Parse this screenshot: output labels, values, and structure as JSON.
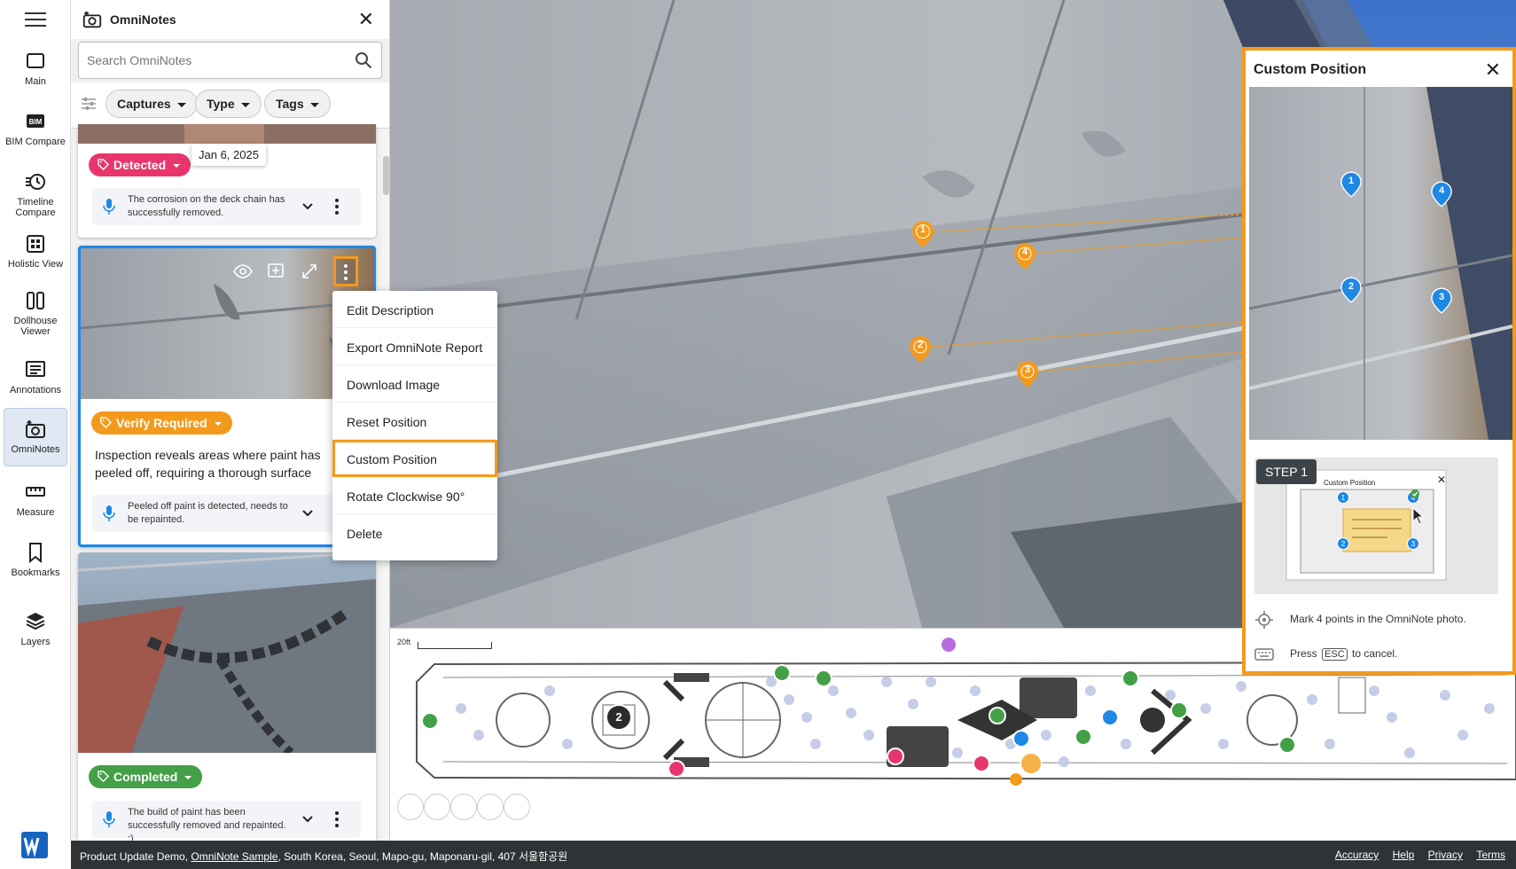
{
  "rail": {
    "items": [
      {
        "label": "Main",
        "icon": "square-icon"
      },
      {
        "label": "BIM Compare",
        "icon": "bim-icon"
      },
      {
        "label": "Timeline Compare",
        "icon": "timeline-icon"
      },
      {
        "label": "Holistic View",
        "icon": "grid-icon"
      },
      {
        "label": "Dollhouse Viewer",
        "icon": "dollhouse-icon"
      },
      {
        "label": "Annotations",
        "icon": "annotations-icon"
      },
      {
        "label": "OmniNotes",
        "icon": "camera-note-icon"
      },
      {
        "label": "Measure",
        "icon": "ruler-icon"
      },
      {
        "label": "Bookmarks",
        "icon": "bookmark-icon"
      },
      {
        "label": "Layers",
        "icon": "layers-icon"
      }
    ],
    "active": "OmniNotes"
  },
  "panel": {
    "title": "OmniNotes",
    "search_placeholder": "Search OmniNotes",
    "filters": [
      "Captures",
      "Type",
      "Tags"
    ]
  },
  "cards": [
    {
      "tag": "Detected",
      "tag_color": "#e8366d",
      "date": "Jan 6, 2025",
      "voice": "The corrosion on the deck chain has successfully removed."
    },
    {
      "tag": "Verify Required",
      "tag_color": "#f39a1c",
      "description": "Inspection reveals areas where paint has peeled off, requiring a thorough surface preparation",
      "voice": "Peeled off paint is detected, needs to be repainted."
    },
    {
      "tag": "Completed",
      "tag_color": "#43a047",
      "voice": "The build of paint has been successfully removed and repainted. :)"
    }
  ],
  "menu": {
    "items": [
      "Edit Description",
      "Export OmniNote Report",
      "Download Image",
      "Reset Position",
      "Custom Position",
      "Rotate Clockwise 90°",
      "Delete"
    ],
    "highlighted": "Custom Position"
  },
  "viewer": {
    "markers": [
      "1",
      "2",
      "3",
      "4"
    ]
  },
  "plan": {
    "scale": "20ft",
    "cluster_count": "2"
  },
  "dialog": {
    "title": "Custom Position",
    "step_label": "STEP 1",
    "thumb_title": "Custom Position",
    "instruction_1": "Mark 4 points in the OmniNote photo.",
    "instruction_2_pre": "Press",
    "instruction_2_key": "ESC",
    "instruction_2_post": "to cancel.",
    "markers": [
      "1",
      "2",
      "3",
      "4"
    ]
  },
  "footer": {
    "project": "Product Update Demo,",
    "sample_link": "OmniNote Sample",
    "address": ", South Korea, Seoul, Mapo-gu, Maponaru-gil, 407 서울함공원",
    "links": [
      "Accuracy",
      "Help",
      "Privacy",
      "Terms"
    ]
  },
  "colors": {
    "accent": "#f39a1c",
    "selected_border": "#1e88e5",
    "marker_blue": "#1e88e5"
  }
}
